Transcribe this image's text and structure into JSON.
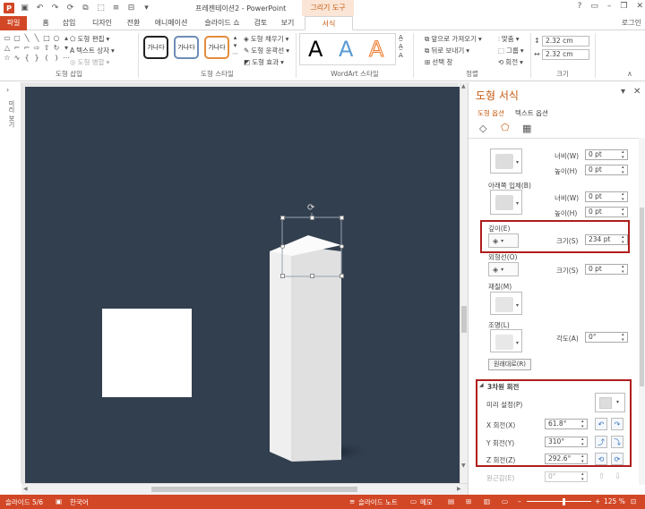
{
  "titlebar": {
    "doc_title": "프레젠테이션2 - PowerPoint",
    "context_tab_title": "그리기 도구",
    "win_controls": [
      "?",
      "▭",
      "–",
      "❐",
      "✕"
    ]
  },
  "tabs": [
    {
      "label": "파일"
    },
    {
      "label": "홈"
    },
    {
      "label": "삽입"
    },
    {
      "label": "디자인"
    },
    {
      "label": "전환"
    },
    {
      "label": "애니메이션"
    },
    {
      "label": "슬라이드 쇼"
    },
    {
      "label": "검토"
    },
    {
      "label": "보기"
    },
    {
      "label": "서식"
    }
  ],
  "user_name": "로그인",
  "ribbon": {
    "insert_shapes": {
      "label": "도형 삽입",
      "edit_shape": "도형 편집",
      "text_box": "텍스트 상자",
      "merge_shapes": "도형 병합"
    },
    "shape_styles": {
      "label": "도형 스타일",
      "preset_text": "가나다",
      "fill": "도형 채우기",
      "outline": "도형 윤곽선",
      "effects": "도형 효과"
    },
    "wordart": {
      "label": "WordArt 스타일",
      "letter": "A"
    },
    "arrange": {
      "label": "정렬",
      "bring_forward": "앞으로 가져오기",
      "send_backward": "뒤로 보내기",
      "selection_pane": "선택 창",
      "align": "맞춤",
      "group": "그룹",
      "rotate": "회전"
    },
    "size": {
      "label": "크기",
      "height": "2.32 cm",
      "width": "2.32 cm"
    }
  },
  "left_strip_text": "미리 보기",
  "pane": {
    "title": "도형 서식",
    "tab_shape_options": "도형 옵션",
    "tab_text_options": "텍스트 옵션",
    "width_label": "너비(W)",
    "height_label": "높이(H)",
    "top_bevel": {
      "width": "0 pt",
      "height": "0 pt"
    },
    "bottom_bevel_label": "아래쪽 입체(B)",
    "bottom_bevel": {
      "width": "0 pt",
      "height": "0 pt"
    },
    "depth_label": "깊이(E)",
    "depth_size_label": "크기(S)",
    "depth_size": "234 pt",
    "contour_label": "외형선(O)",
    "contour_size_label": "크기(S)",
    "contour_size": "0 pt",
    "material_label": "재질(M)",
    "lighting_label": "조명(L)",
    "angle_label": "각도(A)",
    "angle": "0°",
    "reset_button": "원래대로(R)",
    "rotation_section": "3차원 회전",
    "presets_label": "미리 설정(P)",
    "x_rotation_label": "X 회전(X)",
    "x_rotation": "61.8°",
    "y_rotation_label": "Y 회전(Y)",
    "y_rotation": "310°",
    "z_rotation_label": "Z 회전(Z)",
    "z_rotation": "292.6°",
    "perspective_label": "원근감(E)",
    "perspective": "0°"
  },
  "statusbar": {
    "slide_info": "슬라이드 5/6",
    "language": "한국어",
    "notes": "슬라이드 노트",
    "memo": "메모",
    "zoom": "125 %"
  },
  "colors": {
    "accent": "#d24726",
    "highlight_border": "#b01d1d",
    "slide_bg": "#323f4f",
    "format_tab_text": "#c55a11"
  }
}
